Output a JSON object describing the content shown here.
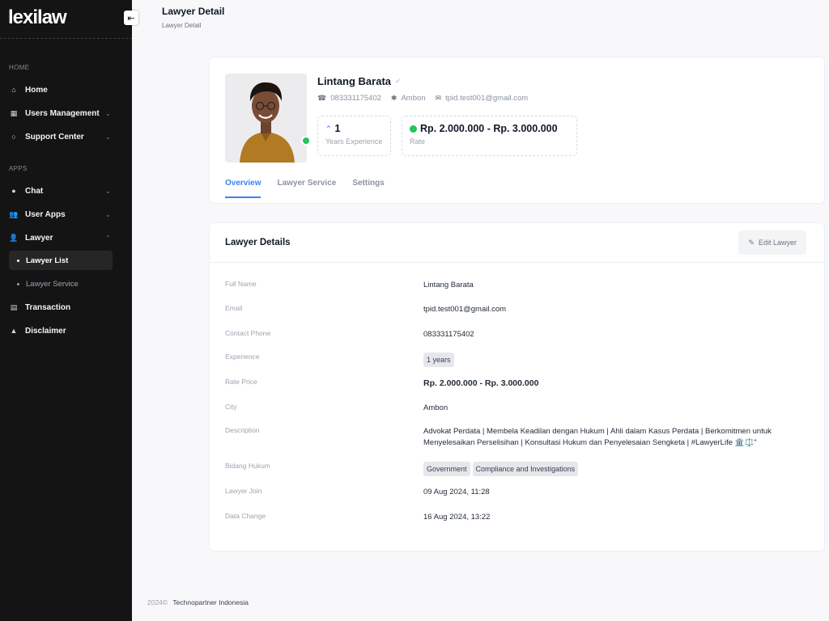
{
  "sidebar": {
    "logo": "lexilaw",
    "toggle_icon": "arrow-left-icon",
    "sections": {
      "home": "HOME",
      "apps": "APPS"
    },
    "items": [
      {
        "label": "Home",
        "icon": "home-icon"
      },
      {
        "label": "Users Management",
        "icon": "grid-icon"
      },
      {
        "label": "Support Center",
        "icon": "lifebuoy-icon"
      },
      {
        "label": "Chat",
        "icon": "chat-icon"
      },
      {
        "label": "User Apps",
        "icon": "users-icon"
      },
      {
        "label": "Lawyer",
        "icon": "user-icon"
      },
      {
        "label": "Transaction",
        "icon": "list-icon"
      },
      {
        "label": "Disclaimer",
        "icon": "warning-icon"
      }
    ],
    "sub_items": [
      {
        "label": "Lawyer List",
        "active": true
      },
      {
        "label": "Lawyer Service",
        "active": false
      }
    ]
  },
  "header": {
    "title": "Lawyer Detail",
    "breadcrumb": "Lawyer Detail"
  },
  "profile": {
    "name": "Lintang Barata",
    "phone": "083331175402",
    "city": "Ambon",
    "email": "tpid.test001@gmail.com",
    "online_color": "#22c55e",
    "stats": [
      {
        "value": "1",
        "label": "Years Experience"
      },
      {
        "value": "Rp. 2.000.000 - Rp. 3.000.000",
        "label": "Rate"
      }
    ],
    "tabs": [
      "Overview",
      "Lawyer Service",
      "Settings"
    ],
    "active_tab": "Overview"
  },
  "details": {
    "title": "Lawyer Details",
    "edit_label": "Edit Lawyer",
    "rows": {
      "full_name": {
        "label": "Full Name",
        "value": "Lintang Barata"
      },
      "email": {
        "label": "Email",
        "value": "tpid.test001@gmail.com"
      },
      "phone": {
        "label": "Contact Phone",
        "value": "083331175402"
      },
      "experience": {
        "label": "Experience",
        "value": "1 years"
      },
      "rate": {
        "label": "Rate Price",
        "value": "Rp. 2.000.000 - Rp. 3.000.000"
      },
      "city": {
        "label": "City",
        "value": "Ambon"
      },
      "description": {
        "label": "Description",
        "value": "Advokat Perdata | Membela Keadilan dengan Hukum | Ahli dalam Kasus Perdata | Berkomitmen untuk Menyelesaikan Perselisihan | Konsultasi Hukum dan Penyelesaian Sengketa | #LawyerLife 🏛️⚖️\""
      },
      "bidang": {
        "label": "Bidang Hukum",
        "values": [
          "Government",
          "Compliance and Investigations"
        ]
      },
      "join": {
        "label": "Lawyer Join",
        "value": "09 Aug 2024, 11:28"
      },
      "change": {
        "label": "Data Change",
        "value": "16 Aug 2024, 13:22"
      }
    }
  },
  "footer": {
    "year": "2024©",
    "company": "Technopartner Indonesia"
  },
  "colors": {
    "accent": "#3b82f6",
    "sidebar_bg": "#141414"
  }
}
